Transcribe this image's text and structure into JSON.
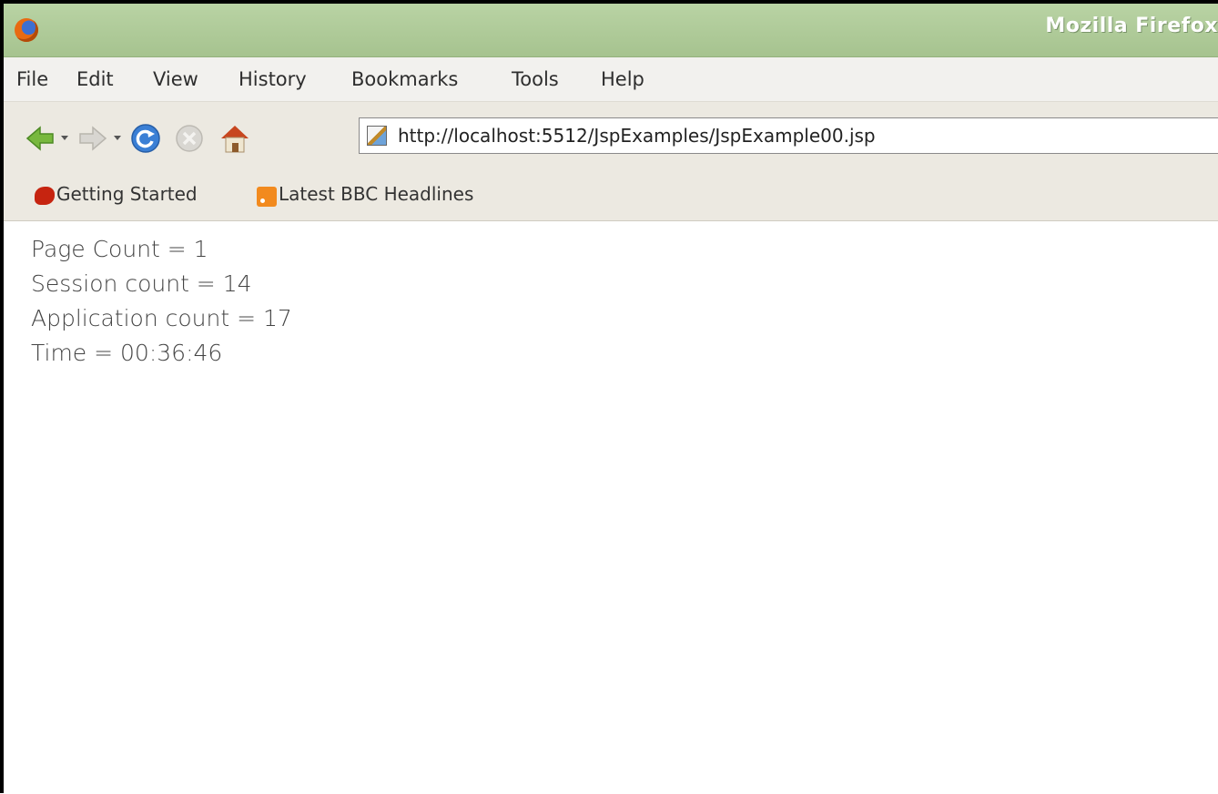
{
  "window": {
    "title": "Mozilla Firefox"
  },
  "menubar": {
    "items": [
      "File",
      "Edit",
      "View",
      "History",
      "Bookmarks",
      "Tools",
      "Help"
    ]
  },
  "navbar": {
    "url": "http://localhost:5512/JspExamples/JspExample00.jsp",
    "icons": [
      "back-icon",
      "forward-icon",
      "reload-icon",
      "stop-icon",
      "home-icon",
      "page-icon"
    ]
  },
  "bookmarks": {
    "items": [
      "Getting Started",
      "Latest BBC Headlines"
    ]
  },
  "content": {
    "lines": [
      "Page Count = 1",
      "Session count = 14",
      "Application count = 17",
      "Time = 00:36:46"
    ]
  }
}
